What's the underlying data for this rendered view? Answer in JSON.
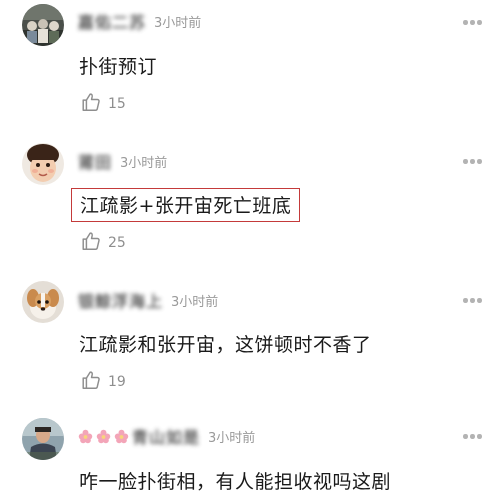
{
  "comments": [
    {
      "username": "嘉佑二苏",
      "time": "3小时前",
      "text": "扑街预订",
      "likes": "15",
      "avatar": "photo-dark-group",
      "highlighted": false
    },
    {
      "username": "莆田",
      "time": "3小时前",
      "text": "江疏影+张开宙死亡班底",
      "likes": "25",
      "avatar": "child-face",
      "highlighted": true,
      "highlight_color": "#c43a3a"
    },
    {
      "username": "银鲸浮海上",
      "time": "3小时前",
      "text": "江疏影和张开宙，这饼顿时不香了",
      "likes": "19",
      "avatar": "small-dog",
      "highlighted": false
    },
    {
      "username": "青山如是",
      "time": "3小时前",
      "text": "咋一脸扑街相，有人能担收视吗这剧",
      "likes": "",
      "avatar": "person-outdoor",
      "highlighted": false,
      "name_prefix_icons": [
        "flower-icon",
        "flower-icon",
        "flower-icon"
      ]
    }
  ],
  "colors": {
    "text": "#1a1a1a",
    "time": "#9a9a9a",
    "like": "#8e8e8e",
    "highlight_border": "#c43a3a"
  }
}
